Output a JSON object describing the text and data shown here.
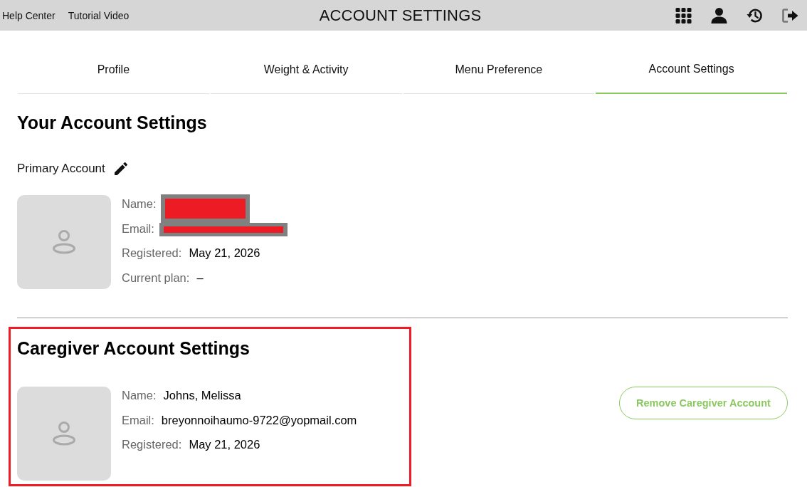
{
  "top_bar": {
    "links": [
      "Help Center",
      "Tutorial Video"
    ],
    "title": "ACCOUNT SETTINGS"
  },
  "tabs": [
    {
      "label": "Profile",
      "selected": false
    },
    {
      "label": "Weight & Activity",
      "selected": false
    },
    {
      "label": "Menu Preference",
      "selected": false
    },
    {
      "label": "Account Settings",
      "selected": true
    }
  ],
  "your_account": {
    "heading": "Your Account Settings",
    "subheading": "Primary Account",
    "fields": [
      {
        "label": "Name:",
        "redacted": true
      },
      {
        "label": "Email:",
        "redacted": true
      },
      {
        "label": "Registered:",
        "value": "May 21, 2026",
        "redacted": false
      },
      {
        "label": "Current plan:",
        "value": "–",
        "redacted": false
      }
    ]
  },
  "caregiver": {
    "heading": "Caregiver Account Settings",
    "highlighted": true,
    "fields": [
      {
        "label": "Name:",
        "value": "Johns, Melissa"
      },
      {
        "label": "Email:",
        "value": "breyonnoihaumo-9722@yopmail.com"
      },
      {
        "label": "Registered:",
        "value": "May 21, 2026"
      }
    ],
    "button": "Remove Caregiver Account"
  }
}
